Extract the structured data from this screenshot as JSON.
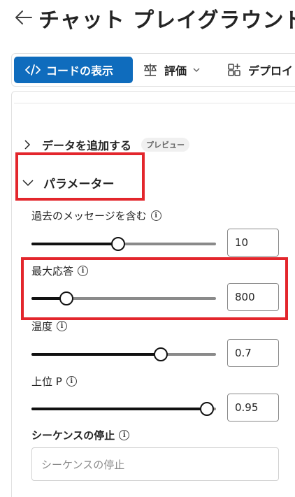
{
  "header": {
    "title": "チャット プレイグラウンド"
  },
  "toolbar": {
    "code_label": "コードの表示",
    "eval_label": "評価",
    "deploy_label": "デプロイ"
  },
  "sections": {
    "data_label": "データを追加する",
    "data_badge": "プレビュー",
    "params_label": "パラメーター"
  },
  "params": {
    "past_messages": {
      "label": "過去のメッセージを含む",
      "value": "10",
      "fraction": 0.47
    },
    "max_response": {
      "label": "最大応答",
      "value": "800",
      "fraction": 0.19
    },
    "temperature": {
      "label": "温度",
      "value": "0.7",
      "fraction": 0.7
    },
    "top_p": {
      "label": "上位 P",
      "value": "0.95",
      "fraction": 0.95
    }
  },
  "stop": {
    "label": "シーケンスの停止",
    "placeholder": "シーケンスの停止"
  },
  "colors": {
    "accent": "#0f6cbd",
    "highlight": "#e3262c"
  }
}
